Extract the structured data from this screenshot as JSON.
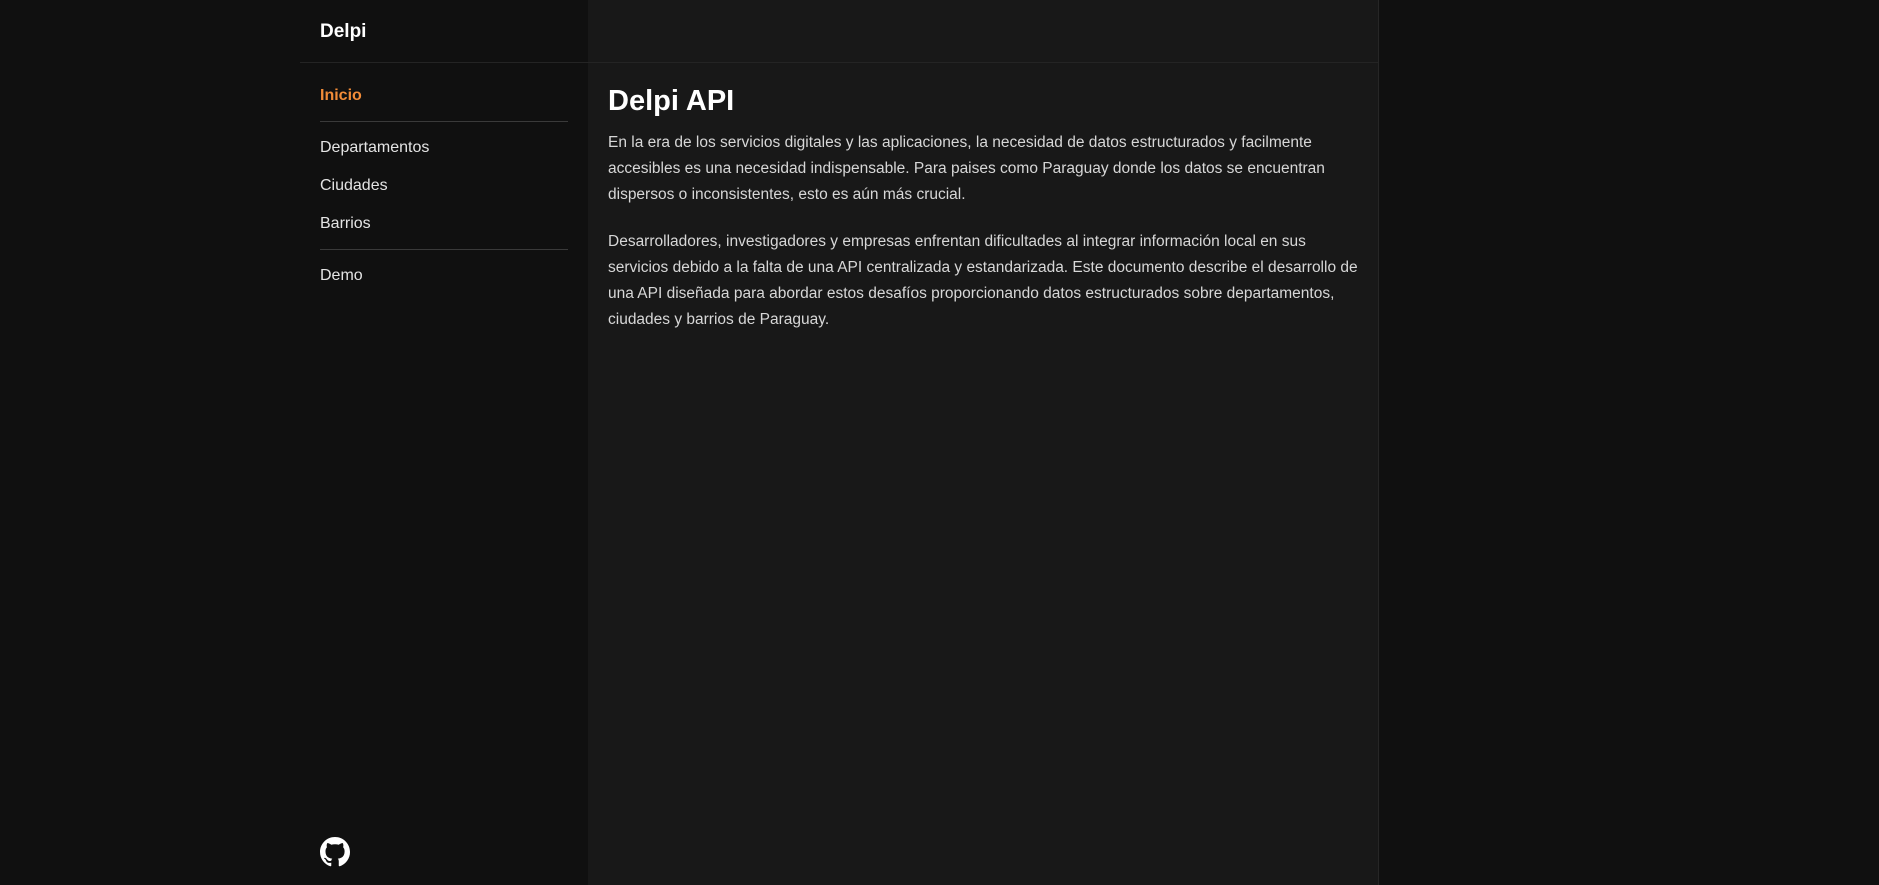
{
  "brand": "Delpi",
  "nav": {
    "inicio": "Inicio",
    "departamentos": "Departamentos",
    "ciudades": "Ciudades",
    "barrios": "Barrios",
    "demo": "Demo"
  },
  "main": {
    "title": "Delpi API",
    "paragraphs": [
      "En la era de los servicios digitales y las aplicaciones, la necesidad de datos estructurados y facilmente accesibles es una necesidad indispensable. Para paises como Paraguay donde los datos se encuentran dispersos o inconsistentes, esto es aún más crucial.",
      "Desarrolladores, investigadores y empresas enfrentan dificultades al integrar información local en sus servicios debido a la falta de una API centralizada y estandarizada. Este documento describe el desarrollo de una API diseñada para abordar estos desafíos proporcionando datos estructurados sobre departamentos, ciudades y barrios de Paraguay."
    ]
  },
  "icons": {
    "footer": "github-icon"
  },
  "colors": {
    "accent": "#f28c38",
    "sidebar_bg": "#101010",
    "main_bg": "#181818",
    "text": "#d7d7d7"
  }
}
